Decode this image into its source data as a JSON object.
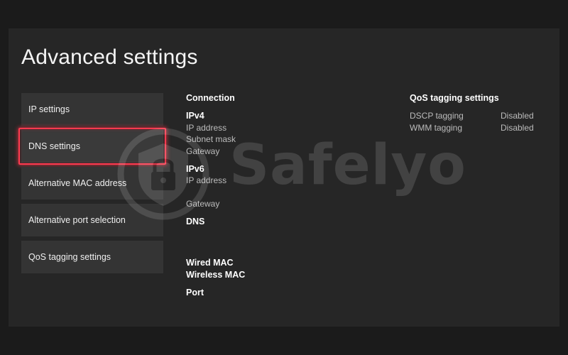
{
  "page": {
    "title": "Advanced settings"
  },
  "menu": {
    "items": [
      {
        "label": "IP settings"
      },
      {
        "label": "DNS settings"
      },
      {
        "label": "Alternative MAC address"
      },
      {
        "label": "Alternative port selection"
      },
      {
        "label": "QoS tagging settings"
      }
    ],
    "selected": "DNS settings"
  },
  "connection": {
    "heading": "Connection",
    "ipv4": {
      "heading": "IPv4",
      "fields": [
        "IP address",
        "Subnet mask",
        "Gateway"
      ]
    },
    "ipv6": {
      "heading": "IPv6",
      "ip_label": "IP address",
      "gateway_label": "Gateway"
    },
    "dns": {
      "heading": "DNS"
    },
    "wired_mac": {
      "heading": "Wired MAC"
    },
    "wireless_mac": {
      "heading": "Wireless MAC"
    },
    "port": {
      "heading": "Port"
    }
  },
  "qos": {
    "heading": "QoS tagging settings",
    "rows": [
      {
        "label": "DSCP tagging",
        "value": "Disabled"
      },
      {
        "label": "WMM tagging",
        "value": "Disabled"
      }
    ]
  },
  "watermark": {
    "text": "Safelyo",
    "icon": "shield-lock-icon"
  },
  "colors": {
    "background": "#1b1b1b",
    "panel": "#262626",
    "menu_item": "#343434",
    "focus_highlight": "#ff3a4f",
    "secondary_text": "#bcbcbc"
  }
}
